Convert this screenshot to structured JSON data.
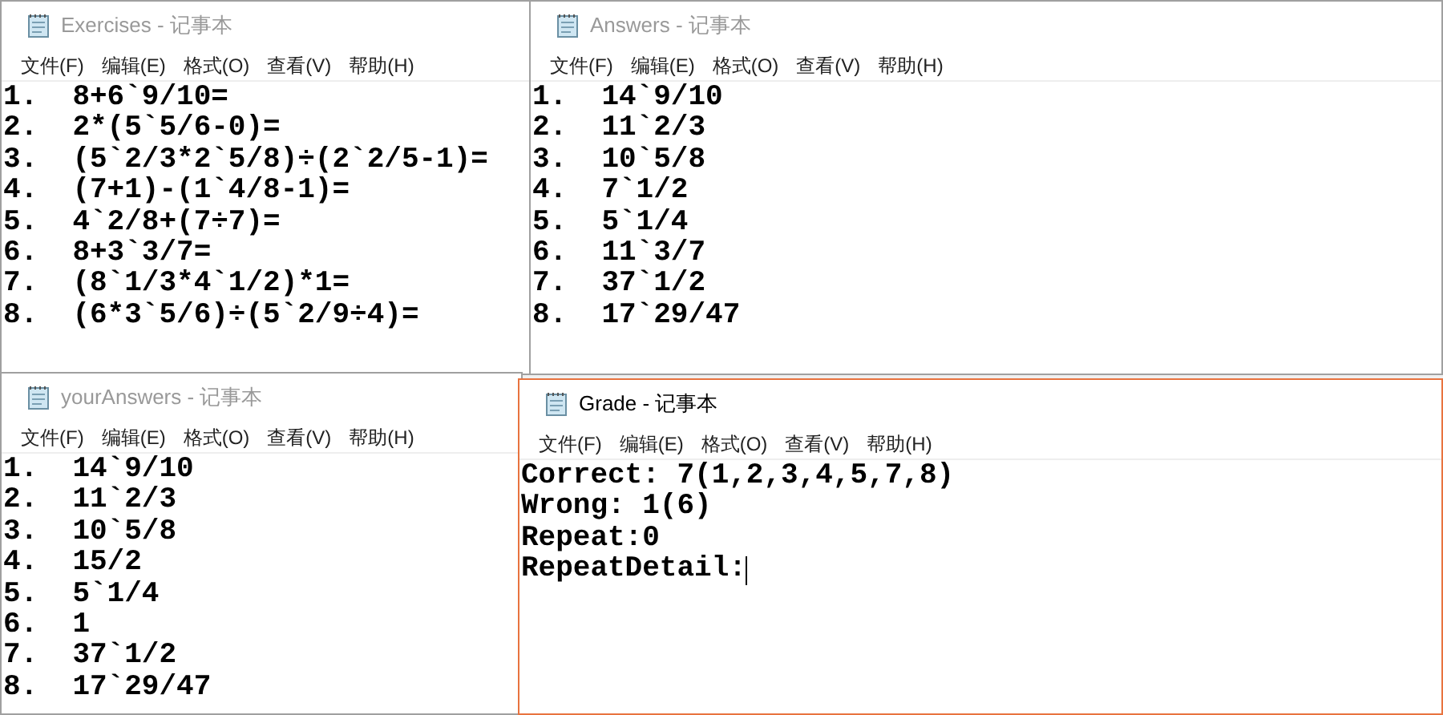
{
  "windows": [
    {
      "title": "Exercises - 记事本",
      "active": false,
      "menu": [
        "文件(F)",
        "编辑(E)",
        "格式(O)",
        "查看(V)",
        "帮助(H)"
      ],
      "lines": [
        "1.  8+6`9/10=",
        "2.  2*(5`5/6-0)=",
        "3.  (5`2/3*2`5/8)÷(2`2/5-1)=",
        "4.  (7+1)-(1`4/8-1)=",
        "5.  4`2/8+(7÷7)=",
        "6.  8+3`3/7=",
        "7.  (8`1/3*4`1/2)*1=",
        "8.  (6*3`5/6)÷(5`2/9÷4)="
      ],
      "caret": false
    },
    {
      "title": "Answers - 记事本",
      "active": false,
      "menu": [
        "文件(F)",
        "编辑(E)",
        "格式(O)",
        "查看(V)",
        "帮助(H)"
      ],
      "lines": [
        "1.  14`9/10",
        "2.  11`2/3",
        "3.  10`5/8",
        "4.  7`1/2",
        "5.  5`1/4",
        "6.  11`3/7",
        "7.  37`1/2",
        "8.  17`29/47"
      ],
      "caret": false
    },
    {
      "title": "yourAnswers - 记事本",
      "active": false,
      "menu": [
        "文件(F)",
        "编辑(E)",
        "格式(O)",
        "查看(V)",
        "帮助(H)"
      ],
      "lines": [
        "1.  14`9/10",
        "2.  11`2/3",
        "3.  10`5/8",
        "4.  15/2",
        "5.  5`1/4",
        "6.  1",
        "7.  37`1/2",
        "8.  17`29/47"
      ],
      "caret": false
    },
    {
      "title": "Grade - 记事本",
      "active": true,
      "menu": [
        "文件(F)",
        "编辑(E)",
        "格式(O)",
        "查看(V)",
        "帮助(H)"
      ],
      "lines": [
        "Correct: 7(1,2,3,4,5,7,8)",
        "Wrong: 1(6)",
        "Repeat:0",
        "RepeatDetail:"
      ],
      "caret": true
    }
  ]
}
